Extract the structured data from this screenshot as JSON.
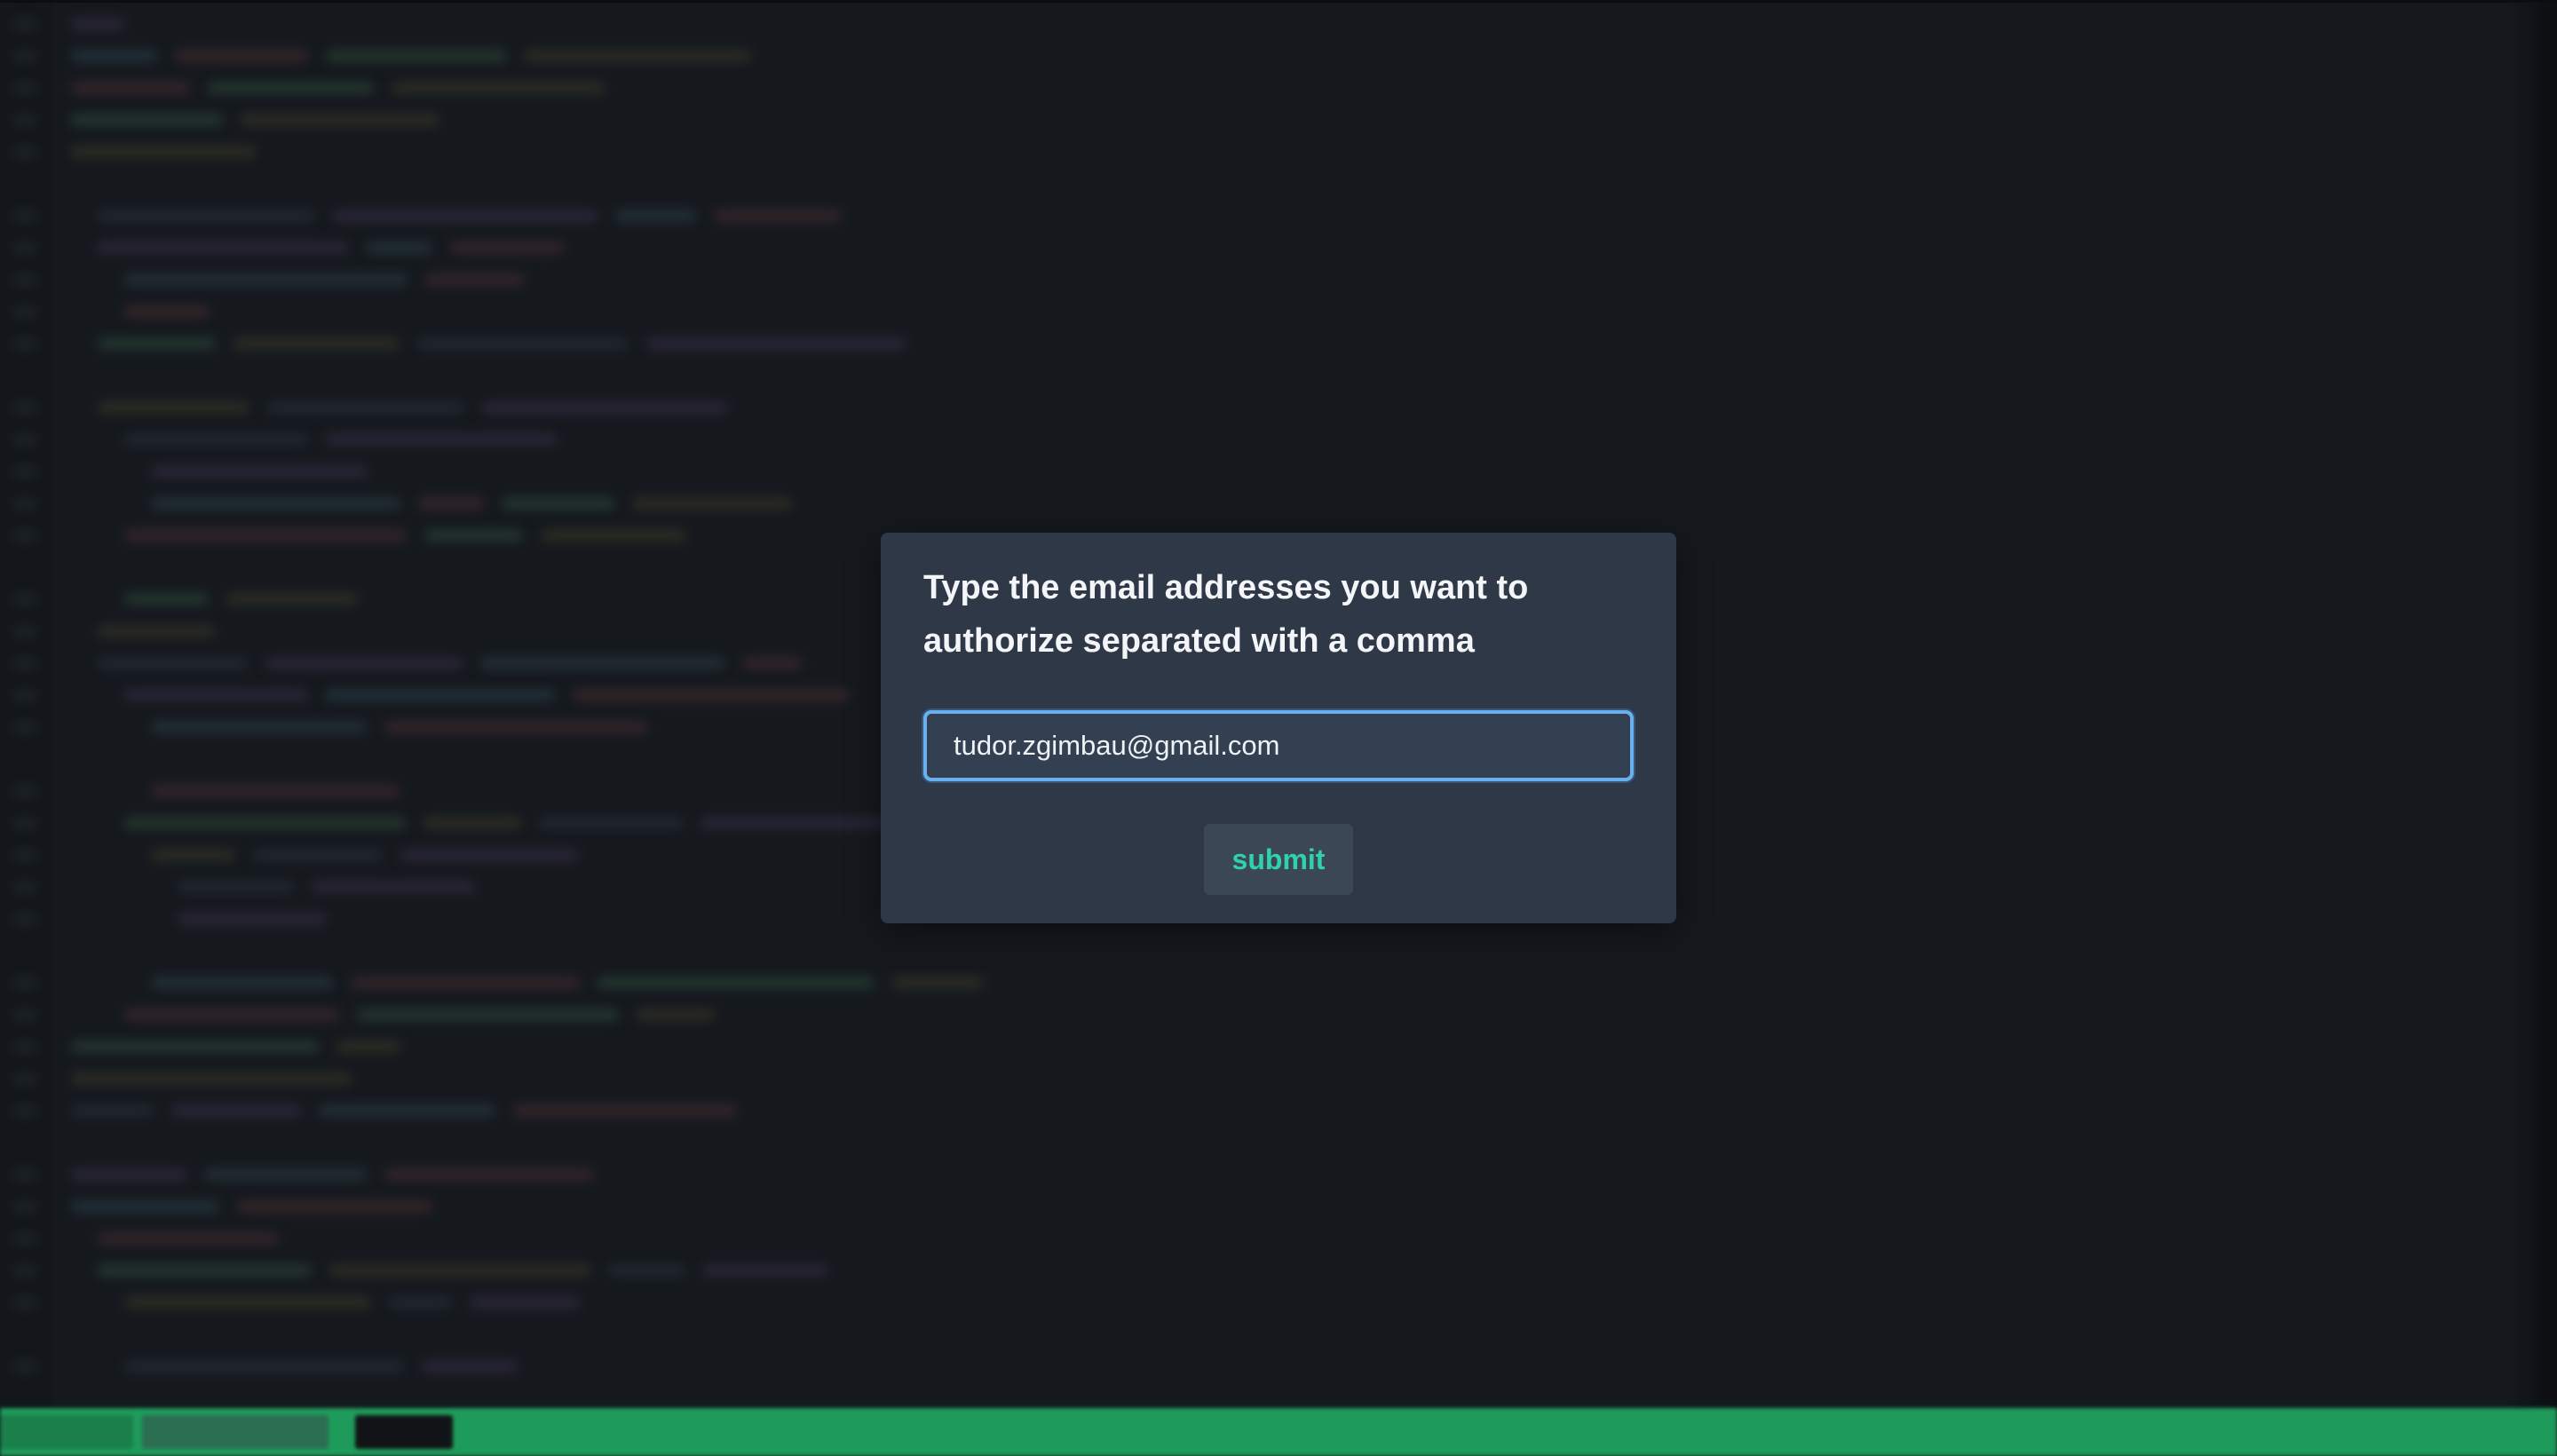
{
  "modal": {
    "title": "Type the email addresses you want to authorize separated with a comma",
    "email_input_value": "tudor.zgimbau@gmail.com",
    "submit_label": "submit"
  },
  "colors": {
    "modal_background": "#2e3847",
    "input_focus_border": "#67b1ef",
    "submit_text": "#2fd3ab",
    "status_bar": "#1e9b5a"
  }
}
